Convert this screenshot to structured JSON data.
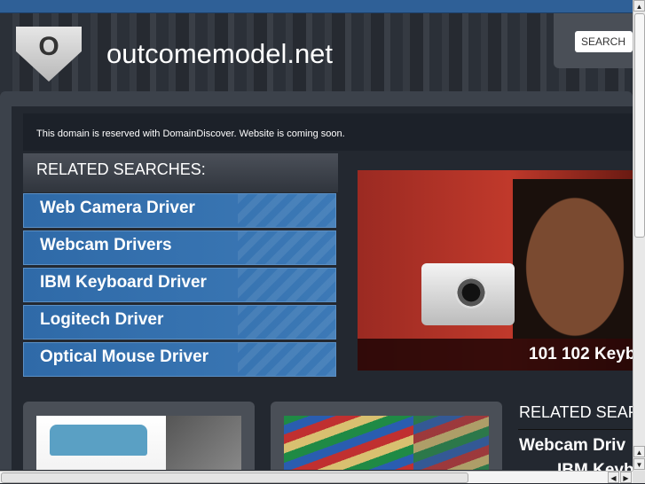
{
  "header": {
    "logo_letter": "O",
    "site_title": "outcomemodel.net",
    "search_label": "SEARCH"
  },
  "notice": "This domain is reserved with DomainDiscover. Website is coming soon.",
  "related": {
    "heading": "RELATED SEARCHES:",
    "items": [
      "Web Camera Driver",
      "Webcam Drivers",
      "IBM Keyboard Driver",
      "Logitech Driver",
      "Optical Mouse Driver"
    ]
  },
  "hero": {
    "caption": "101 102 Keyb"
  },
  "related_right": {
    "heading": "RELATED SEAR",
    "items": [
      "Webcam Driv",
      "IBM Keyb"
    ]
  },
  "colors": {
    "accent": "#2f6aa8",
    "topbar": "#2f6097"
  }
}
